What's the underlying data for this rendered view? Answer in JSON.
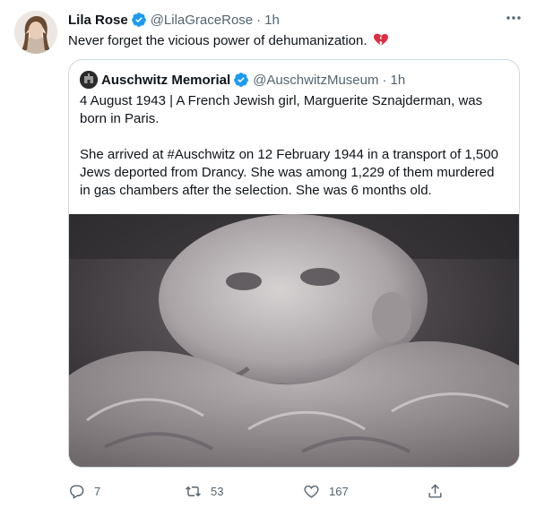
{
  "tweet": {
    "author_name": "Lila Rose",
    "author_handle": "@LilaGraceRose",
    "separator": "·",
    "time": "1h",
    "text": "Never forget the vicious power of dehumanization.",
    "emoji": "💔",
    "avatar_icon": "person-portrait"
  },
  "quoted": {
    "author_name": "Auschwitz Memorial",
    "author_handle": "@AuschwitzMuseum",
    "separator": "·",
    "time": "1h",
    "paragraphs": [
      "4 August 1943 | A French Jewish girl, Marguerite Sznajderman, was born in Paris.",
      "She arrived at #Auschwitz on 12 February 1944 in a transport of 1,500 Jews deported from Drancy. She was among 1,229 of them murdered in gas chambers after the selection. She was 6 months old."
    ],
    "image_icon": "black-and-white-baby-photo"
  },
  "actions": {
    "reply_count": "7",
    "retweet_count": "53",
    "like_count": "167"
  },
  "colors": {
    "verified": "#1d9bf0",
    "muted": "#536471",
    "border": "#cfd9de",
    "emoji_heart": "#e0245e"
  }
}
